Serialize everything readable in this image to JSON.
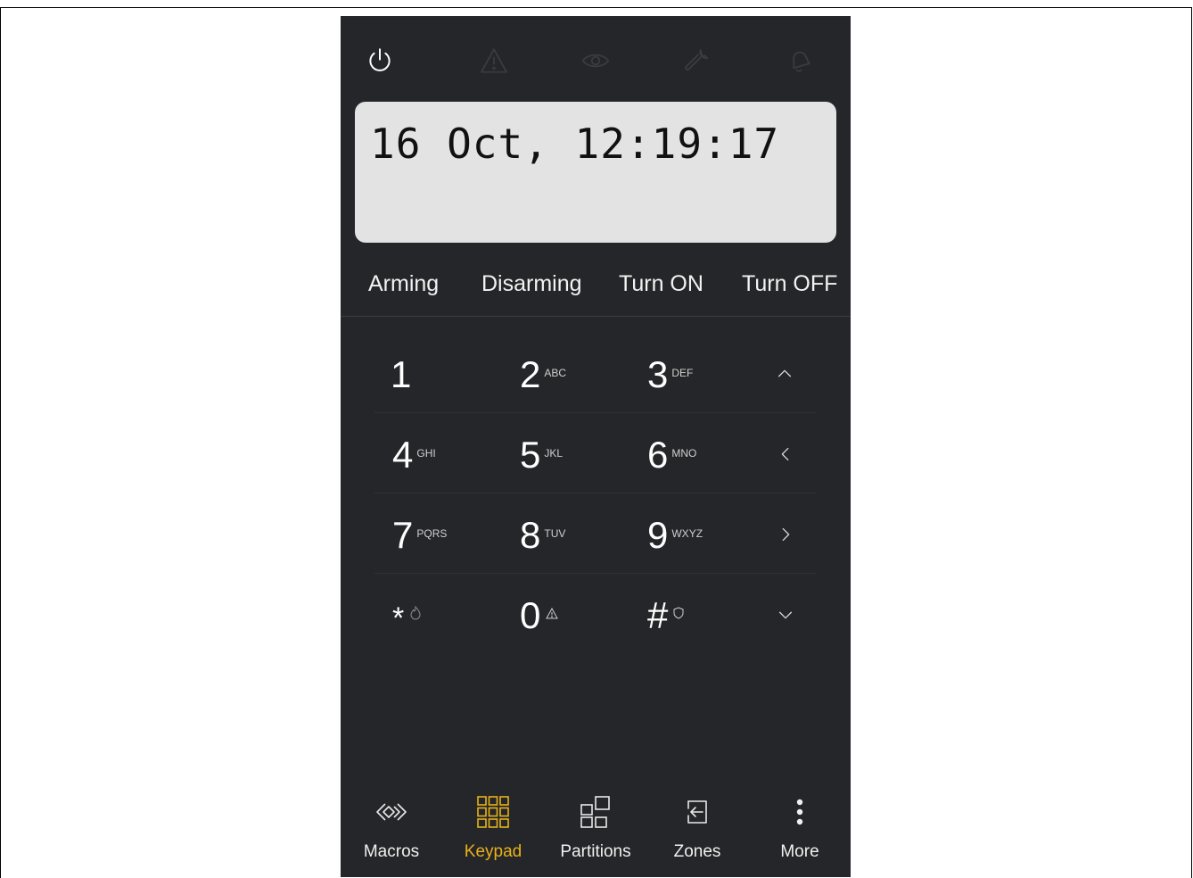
{
  "status_icons": [
    "power-icon",
    "warning-icon",
    "eye-icon",
    "wrench-icon",
    "bell-icon"
  ],
  "display": {
    "text": "16 Oct, 12:19:17"
  },
  "actions": [
    {
      "label": "Arming"
    },
    {
      "label": "Disarming"
    },
    {
      "label": "Turn ON"
    },
    {
      "label": "Turn OFF"
    }
  ],
  "keypad": {
    "keys": [
      {
        "digit": "1",
        "sub": ""
      },
      {
        "digit": "2",
        "sub": "ABC"
      },
      {
        "digit": "3",
        "sub": "DEF"
      },
      {
        "digit": "4",
        "sub": "GHI"
      },
      {
        "digit": "5",
        "sub": "JKL"
      },
      {
        "digit": "6",
        "sub": "MNO"
      },
      {
        "digit": "7",
        "sub": "PQRS"
      },
      {
        "digit": "8",
        "sub": "TUV"
      },
      {
        "digit": "9",
        "sub": "WXYZ"
      },
      {
        "digit": "*",
        "sub_icon": "fire-icon"
      },
      {
        "digit": "0",
        "sub_icon": "warning-icon"
      },
      {
        "digit": "#",
        "sub_icon": "shield-icon"
      }
    ],
    "arrows": [
      "chevron-up-icon",
      "chevron-left-icon",
      "chevron-right-icon",
      "chevron-down-icon"
    ]
  },
  "bottom_nav": {
    "active": "Keypad",
    "items": [
      {
        "label": "Macros",
        "icon": "macros-icon"
      },
      {
        "label": "Keypad",
        "icon": "keypad-grid-icon"
      },
      {
        "label": "Partitions",
        "icon": "partitions-icon"
      },
      {
        "label": "Zones",
        "icon": "zones-icon"
      },
      {
        "label": "More",
        "icon": "more-vertical-icon"
      }
    ]
  },
  "colors": {
    "background": "#252629",
    "accent": "#e8b21a",
    "display_bg": "#e3e3e3",
    "dim_icon": "#3a3b3f"
  }
}
